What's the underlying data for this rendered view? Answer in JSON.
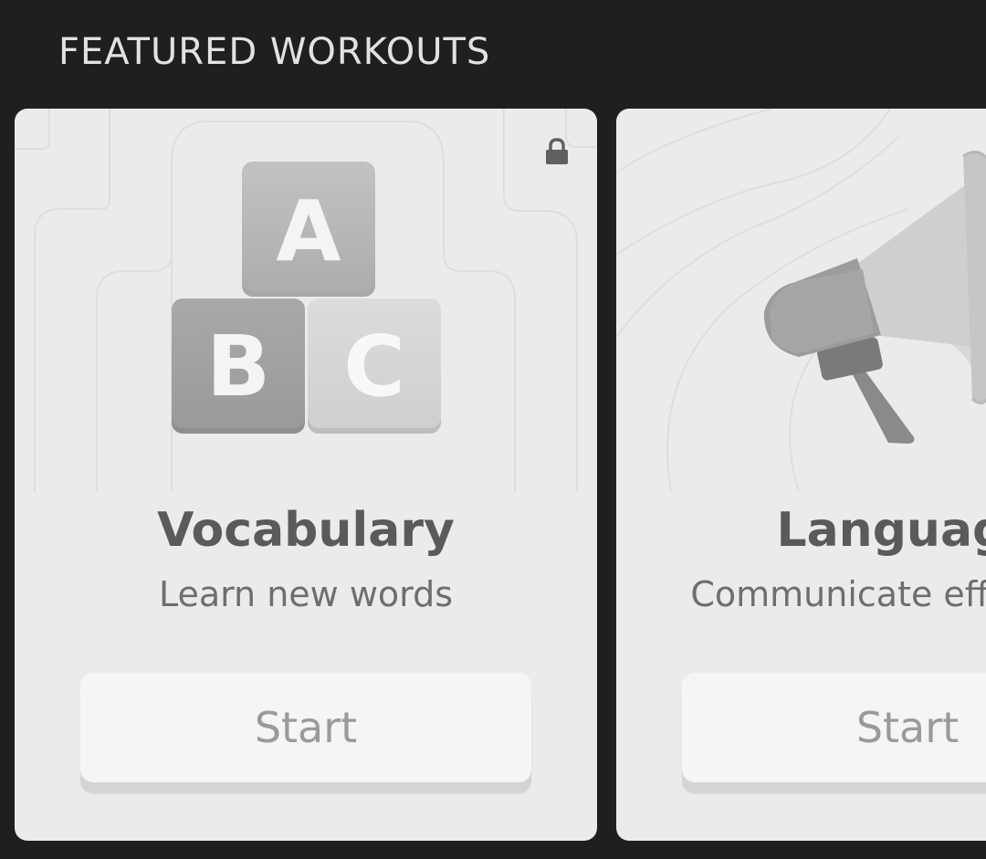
{
  "section": {
    "title": "FEATURED WORKOUTS"
  },
  "cards": [
    {
      "title": "Vocabulary",
      "subtitle": "Learn new words",
      "button_label": "Start",
      "icon": "abc-blocks-icon",
      "locked": true,
      "blocks": [
        "A",
        "B",
        "C"
      ]
    },
    {
      "title": "Language",
      "subtitle": "Communicate effectively",
      "button_label": "Start",
      "icon": "megaphone-icon",
      "locked": false
    }
  ],
  "colors": {
    "background": "#1f1f1f",
    "card": "#ebebeb",
    "title_text": "#5a5a5a",
    "button": "#f5f5f5"
  }
}
